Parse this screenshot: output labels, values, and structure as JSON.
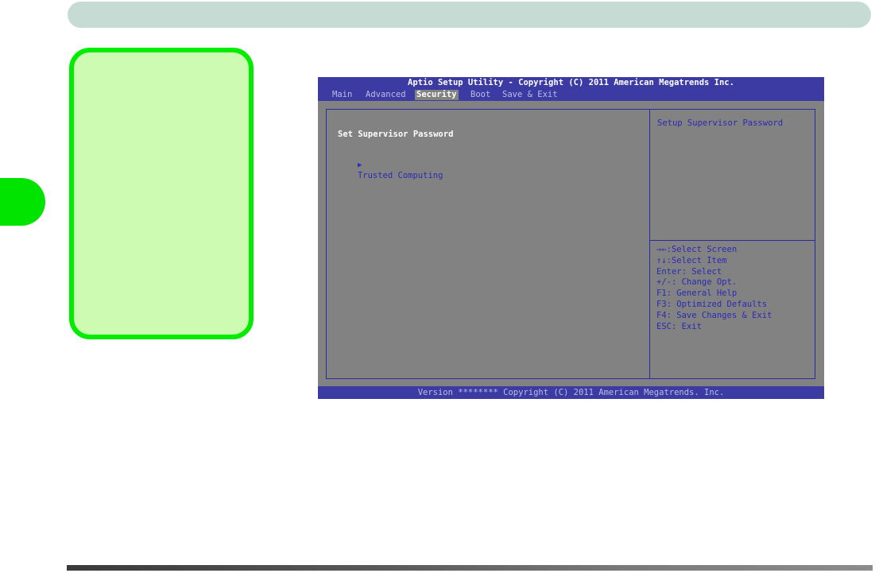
{
  "bios": {
    "title": "Aptio Setup Utility - Copyright (C) 2011 American Megatrends Inc.",
    "tabs": [
      {
        "label": "Main"
      },
      {
        "label": "Advanced"
      },
      {
        "label": "Security"
      },
      {
        "label": "Boot"
      },
      {
        "label": "Save & Exit"
      }
    ],
    "active_tab": "Security",
    "items": [
      {
        "label": "Set Supervisor Password"
      },
      {
        "arrow": "▶",
        "label": "Trusted Computing"
      }
    ],
    "help_text": "Setup Supervisor Password",
    "key_help": [
      "→←:Select Screen",
      "↑↓:Select Item",
      "Enter: Select",
      "+/-: Change Opt.",
      "F1: General Help",
      "F3: Optimized Defaults",
      "F4: Save Changes & Exit",
      "ESC: Exit"
    ],
    "footer": "Version ******** Copyright (C) 2011 American Megatrends. Inc."
  },
  "colors": {
    "header_bar": "#c6dbd3",
    "chapter_tab": "#00e400",
    "note_box_fill": "#cdfbb2",
    "note_box_border": "#00ec00",
    "bios_blue": "#3b3ba3",
    "bios_gray": "#828282"
  }
}
